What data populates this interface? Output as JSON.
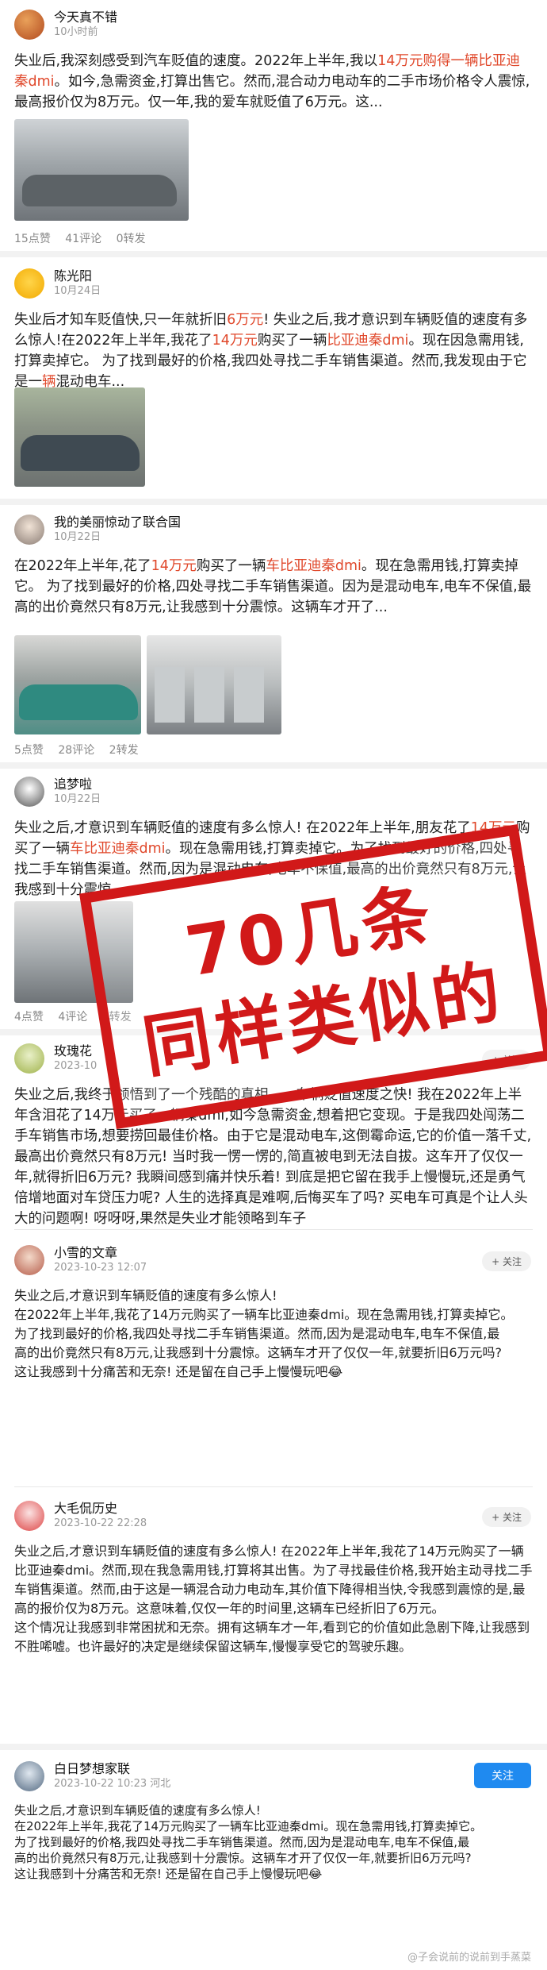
{
  "posts": [
    {
      "user": "今天真不错",
      "time": "10小时前",
      "text_a": "失业后,我深刻感受到汽车贬值的速度。2022年上半年,我以",
      "text_hl": "14万元购得一辆比亚迪秦dmi",
      "text_b": "。如今,急需资金,打算出售它。然而,混合动力电动车的二手市场价格令人震惊,最高报价仅为8万元。仅一年,我的爱车就贬值了6万元。这...",
      "likes": "15点赞",
      "comments": "41评论",
      "shares": "0转发"
    },
    {
      "user": "陈光阳",
      "time": "10月24日",
      "text_a": "失业后才知车贬值快,只一年就折旧",
      "text_hl1": "6万元",
      "text_b": "! 失业之后,我才意识到车辆贬值的速度有多么惊人!在2022年上半年,我花了",
      "text_hl2": "14万元",
      "text_c": "购买了一辆",
      "text_hl3": "比亚迪秦dmi",
      "text_d": "。现在因急需用钱,打算卖掉它。 为了找到最好的价格,我四处寻找二手车销售渠道。然而,我发现由于它是一",
      "text_hl4": "辆",
      "text_e": "混动电车..."
    },
    {
      "user": "我的美丽惊动了联合国",
      "time": "10月22日",
      "text_a": "在2022年上半年,花了",
      "text_hl1": "14万元",
      "text_b": "购买了一辆",
      "text_hl2": "车比亚迪秦dmi",
      "text_c": "。现在急需用钱,打算卖掉它。 为了找到最好的价格,四处寻找二手车销售渠道。因为是混动电车,电车不保值,最高的出价竟然只有8万元,让我感到十分震惊。这辆车才开了...",
      "likes": "5点赞",
      "comments": "28评论",
      "shares": "2转发"
    },
    {
      "user": "追梦啦",
      "time": "10月22日",
      "text_a": "失业之后,才意识到车辆贬值的速度有多么惊人! 在2022年上半年,朋友花了",
      "text_hl1": "14万元",
      "text_b": "购买了一辆",
      "text_hl2": "车比亚迪秦dmi",
      "text_c": "。现在急需用钱,打算卖掉它。为了找到最好的价格,四处寻找二手车销售渠道。然而,因为是混动电车,电车不保值,最高的出价竟然只有8万元,让我感到十分震惊。...",
      "likes": "4点赞",
      "comments": "4评论",
      "shares": "0转发"
    },
    {
      "user": "玫瑰花",
      "time": "2023-10",
      "follow": "+ 关注",
      "text": "失业之后,我终于领悟到了一个残酷的真相——车辆贬值速度之快! 我在2022年上半年含泪花了14万元买了一辆秦dmi,如今急需资金,想着把它变现。于是我四处闯荡二手车销售市场,想要捞回最佳价格。由于它是混动电车,这倒霉命运,它的价值一落千丈,最高出价竟然只有8万元! 当时我一愣一愣的,简直被电到无法自拔。这车开了仅仅一年,就得折旧6万元? 我瞬间感到痛并快乐着! 到底是把它留在我手上慢慢玩,还是勇气倍增地面对车贷压力呢? 人生的选择真是难啊,后悔买车了吗? 买电车可真是个让人头大的问题啊! 呀呀呀,果然是失业才能领略到车子"
    },
    {
      "user": "小雪的文章",
      "time": "2023-10-23 12:07",
      "follow": "+ 关注",
      "text": "失业之后,才意识到车辆贬值的速度有多么惊人!\n在2022年上半年,我花了14万元购买了一辆车比亚迪秦dmi。现在急需用钱,打算卖掉它。\n为了找到最好的价格,我四处寻找二手车销售渠道。然而,因为是混动电车,电车不保值,最\n高的出价竟然只有8万元,让我感到十分震惊。这辆车才开了仅仅一年,就要折旧6万元吗?\n这让我感到十分痛苦和无奈! 还是留在自己手上慢慢玩吧😂"
    },
    {
      "user": "大毛侃历史",
      "time": "2023-10-22 22:28",
      "follow": "+ 关注",
      "text": "失业之后,才意识到车辆贬值的速度有多么惊人! 在2022年上半年,我花了14万元购买了一辆比亚迪秦dmi。然而,现在我急需用钱,打算将其出售。为了寻找最佳价格,我开始主动寻找二手车销售渠道。然而,由于这是一辆混合动力电动车,其价值下降得相当快,令我感到震惊的是,最高的报价仅为8万元。这意味着,仅仅一年的时间里,这辆车已经折旧了6万元。\n这个情况让我感到非常困扰和无奈。拥有这辆车才一年,看到它的价值如此急剧下降,让我感到不胜唏嘘。也许最好的决定是继续保留这辆车,慢慢享受它的驾驶乐趣。"
    },
    {
      "user": "白日梦想家联",
      "time": "2023-10-22 10:23 河北",
      "follow": "关注",
      "text": "失业之后,才意识到车辆贬值的速度有多么惊人!\n在2022年上半年,我花了14万元购买了一辆车比亚迪秦dmi。现在急需用钱,打算卖掉它。\n为了找到最好的价格,我四处寻找二手车销售渠道。然而,因为是混动电车,电车不保值,最\n高的出价竟然只有8万元,让我感到十分震惊。这辆车才开了仅仅一年,就要折旧6万元吗?\n这让我感到十分痛苦和无奈! 还是留在自己手上慢慢玩吧😂"
    }
  ],
  "stamp": {
    "line1": "70几条",
    "line2": "同样类似的"
  },
  "watermark": "@子会说前的说前到手蒸菜"
}
